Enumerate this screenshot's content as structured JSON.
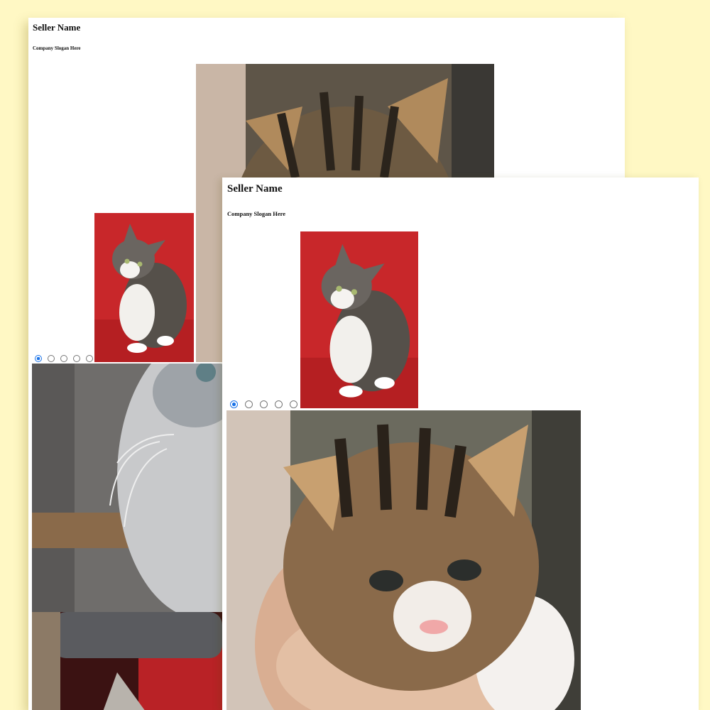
{
  "colors": {
    "background": "#fff8c4",
    "page": "#ffffff",
    "radio_accent": "#1a73e8"
  },
  "windows": [
    {
      "id": "back",
      "seller_name": "Seller Name",
      "slogan": "Company Slogan Here",
      "selected_slide": 1,
      "slide_count": 5,
      "images": [
        {
          "name": "tabby-kitten-close-up",
          "depicts": "tabby kitten held in hand"
        },
        {
          "name": "kitten-on-red-cushion",
          "depicts": "tabby and white kitten sitting on red leather"
        },
        {
          "name": "grey-kitten-whiskers",
          "depicts": "grey kitten face close-up with whiskers"
        },
        {
          "name": "kitten-on-cat-tree",
          "depicts": "kitten on grey cat tree with red background"
        }
      ]
    },
    {
      "id": "front",
      "seller_name": "Seller Name",
      "slogan": "Company Slogan Here",
      "selected_slide": 1,
      "slide_count": 5,
      "images": [
        {
          "name": "kitten-on-red-cushion",
          "depicts": "tabby and white kitten sitting on red leather"
        },
        {
          "name": "tabby-kitten-close-up",
          "depicts": "tabby kitten held in hand"
        }
      ]
    }
  ]
}
